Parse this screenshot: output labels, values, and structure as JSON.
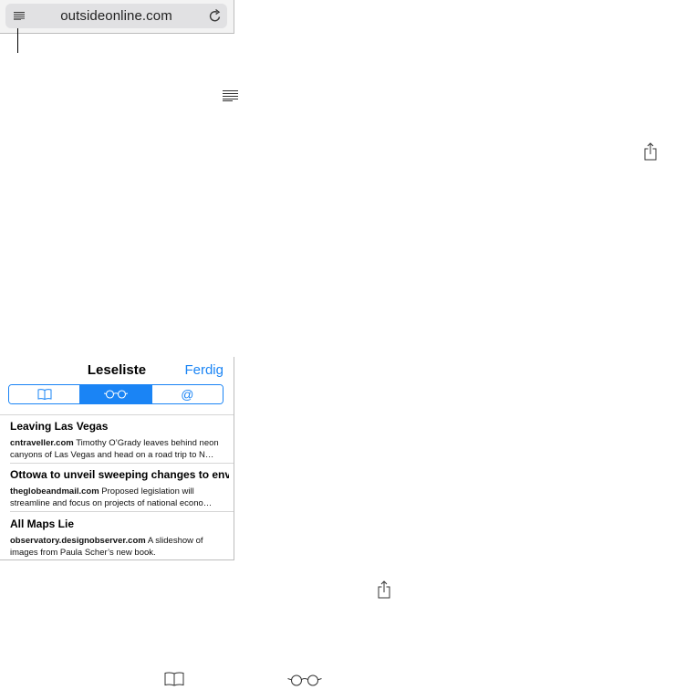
{
  "address_bar": {
    "url": "outsideonline.com",
    "icons": {
      "reader": "reader-icon",
      "reload": "reload-icon"
    }
  },
  "standalone_icons": [
    "reader-icon",
    "share-icon",
    "share-icon",
    "book-icon",
    "glasses-icon"
  ],
  "reading_list": {
    "title": "Leseliste",
    "done_label": "Ferdig",
    "tabs": [
      {
        "icon": "book-icon",
        "active": false
      },
      {
        "icon": "glasses-icon",
        "active": true
      },
      {
        "label": "@",
        "active": false
      }
    ],
    "items": [
      {
        "title": "Leaving Las Vegas",
        "source": "cntraveller.com",
        "summary": "Timothy O’Grady leaves behind neon canyons of Las Vegas and head on a road trip to N…"
      },
      {
        "title": "Ottowa to unveil sweeping changes to envi…",
        "source": "theglobeandmail.com",
        "summary": "Proposed legislation will streamline and focus on projects of national econo…"
      },
      {
        "title": "All Maps Lie",
        "source": "observatory.designobserver.com",
        "summary": "A slideshow of images from Paula Scher’s new book."
      }
    ]
  },
  "colors": {
    "accent": "#1a84f5",
    "field_bg": "#e1e1e3",
    "bar_bg": "#f3f3f3"
  }
}
